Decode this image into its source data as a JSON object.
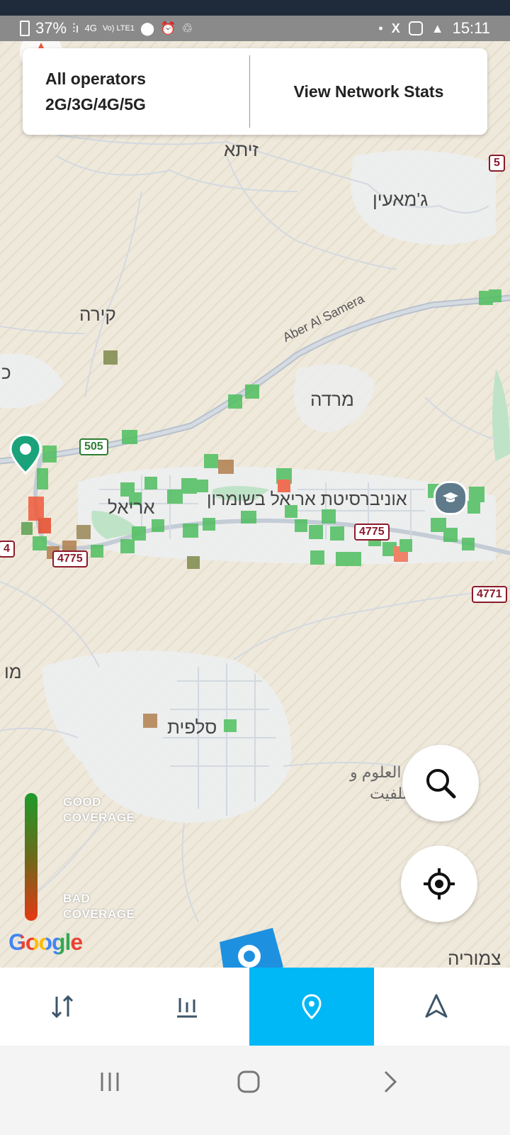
{
  "status_bar": {
    "battery": "37%",
    "network": "4G",
    "volte": "Vo) LTE1",
    "time": "15:11",
    "left_icons": [
      "signal-icon",
      "location-pin-icon",
      "alarm-icon",
      "recycle-icon"
    ],
    "right_icons": [
      "dot-icon",
      "x-icon",
      "instagram-icon",
      "navigation-arrow-icon"
    ]
  },
  "header_card": {
    "operators_line1": "All operators",
    "operators_line2": "2G/3G/4G/5G",
    "stats_button": "View Network Stats"
  },
  "map": {
    "places": {
      "zita": "זיתא",
      "jamain": "ג'מאעין",
      "kira": "קירה",
      "marda": "מרדה",
      "ariel": "אריאל",
      "ariel_univ": "אוניברסיטת אריאל בשומרון",
      "salfit": "סלפית",
      "mo": "מו",
      "ke": "כ",
      "tzamoria": "צמוריה",
      "arabic_line1": "جامعة العلوم و",
      "arabic_line2": "تكنولوجيا سلفيت"
    },
    "road_label": "Aber Al Samera",
    "shields": {
      "r505": "505",
      "r4775a": "4775",
      "r4775b": "4775",
      "r4771": "4771",
      "r5": "5",
      "r4": "4"
    },
    "legend": {
      "good_line1": "GOOD",
      "good_line2": "COVERAGE",
      "bad_line1": "BAD",
      "bad_line2": "COVERAGE"
    },
    "attribution": "Google",
    "colors": {
      "good": "#1e9b2a",
      "bad": "#e53914",
      "pin": "#1aa37a",
      "accent": "#00b8f5"
    }
  },
  "bottom_nav": {
    "items": [
      "speed-test-icon",
      "stats-bars-icon",
      "map-pin-icon",
      "navigation-icon"
    ],
    "active_index": 2
  },
  "system_nav": [
    "recents-icon",
    "home-icon",
    "back-icon"
  ]
}
